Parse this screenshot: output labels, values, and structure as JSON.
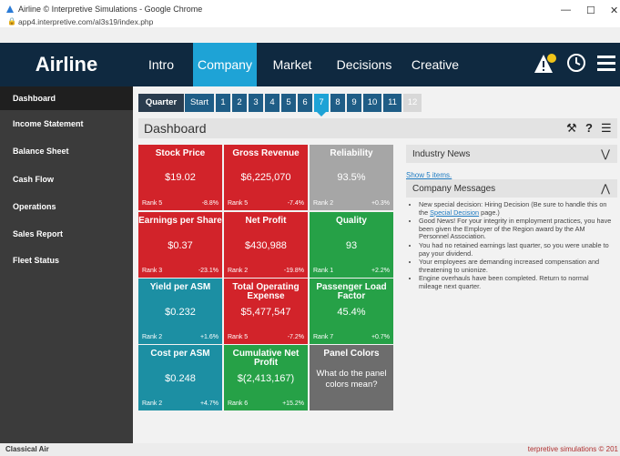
{
  "browser": {
    "title": "Airline © Interpretive Simulations - Google Chrome",
    "url": "app4.interpretive.com/al3s19/index.php"
  },
  "app": {
    "brand": "Airline",
    "nav": [
      "Intro",
      "Company",
      "Market",
      "Decisions",
      "Creative"
    ],
    "active_nav": "Company",
    "alert_count": "2"
  },
  "sidebar": [
    "Dashboard",
    "Income Statement",
    "Balance Sheet",
    "Cash Flow",
    "Operations",
    "Sales Report",
    "Fleet Status"
  ],
  "quarters": {
    "label": "Quarter",
    "start": "Start",
    "items": [
      "1",
      "2",
      "3",
      "4",
      "5",
      "6",
      "7",
      "8",
      "9",
      "10",
      "11",
      "12"
    ],
    "active": "7",
    "disabled": "12"
  },
  "dashboard": {
    "title": "Dashboard",
    "tiles": [
      {
        "title": "Stock Price",
        "value": "$19.02",
        "rank": "Rank 5",
        "change": "-8.8%",
        "color": "#d2232a"
      },
      {
        "title": "Gross Revenue",
        "value": "$6,225,070",
        "rank": "Rank 5",
        "change": "-7.4%",
        "color": "#d2232a"
      },
      {
        "title": "Reliability",
        "value": "93.5%",
        "rank": "Rank 2",
        "change": "+0.3%",
        "color": "#a6a6a6"
      },
      {
        "title": "Earnings per Share",
        "value": "$0.37",
        "rank": "Rank 3",
        "change": "-23.1%",
        "color": "#d2232a"
      },
      {
        "title": "Net Profit",
        "value": "$430,988",
        "rank": "Rank 2",
        "change": "-19.8%",
        "color": "#d2232a"
      },
      {
        "title": "Quality",
        "value": "93",
        "rank": "Rank 1",
        "change": "+2.2%",
        "color": "#26a147"
      },
      {
        "title": "Yield per ASM",
        "value": "$0.232",
        "rank": "Rank 2",
        "change": "+1.6%",
        "color": "#1c8fa3"
      },
      {
        "title": "Total Operating Expense",
        "value": "$5,477,547",
        "rank": "Rank 5",
        "change": "-7.2%",
        "color": "#d2232a"
      },
      {
        "title": "Passenger Load Factor",
        "value": "45.4%",
        "rank": "Rank 7",
        "change": "+0.7%",
        "color": "#26a147"
      },
      {
        "title": "Cost per ASM",
        "value": "$0.248",
        "rank": "Rank 2",
        "change": "+4.7%",
        "color": "#1c8fa3"
      },
      {
        "title": "Cumulative Net Profit",
        "value": "$(2,413,167)",
        "rank": "Rank 6",
        "change": "+15.2%",
        "color": "#26a147"
      }
    ],
    "panel_colors": {
      "title": "Panel Colors",
      "body": "What do the panel colors mean?"
    }
  },
  "news": {
    "title": "Industry News",
    "link": "Show 5 items."
  },
  "messages": {
    "title": "Company Messages",
    "items": [
      {
        "pre": "New special decision: Hiring Decision (Be sure to handle this on the ",
        "link": "Special Decision",
        "post": " page.)"
      },
      {
        "pre": "Good News! For your integrity in employment practices, you have been given the Employer of the Region award by the AM Personnel Association.",
        "link": "",
        "post": ""
      },
      {
        "pre": "You had no retained earnings last quarter, so you were unable to pay your dividend.",
        "link": "",
        "post": ""
      },
      {
        "pre": "Your employees are demanding increased compensation and threatening to unionize.",
        "link": "",
        "post": ""
      },
      {
        "pre": "Engine overhauls have been completed. Return to normal mileage next quarter.",
        "link": "",
        "post": ""
      }
    ]
  },
  "status": {
    "left": "Classical Air",
    "right": "terpretive simulations © 201"
  }
}
